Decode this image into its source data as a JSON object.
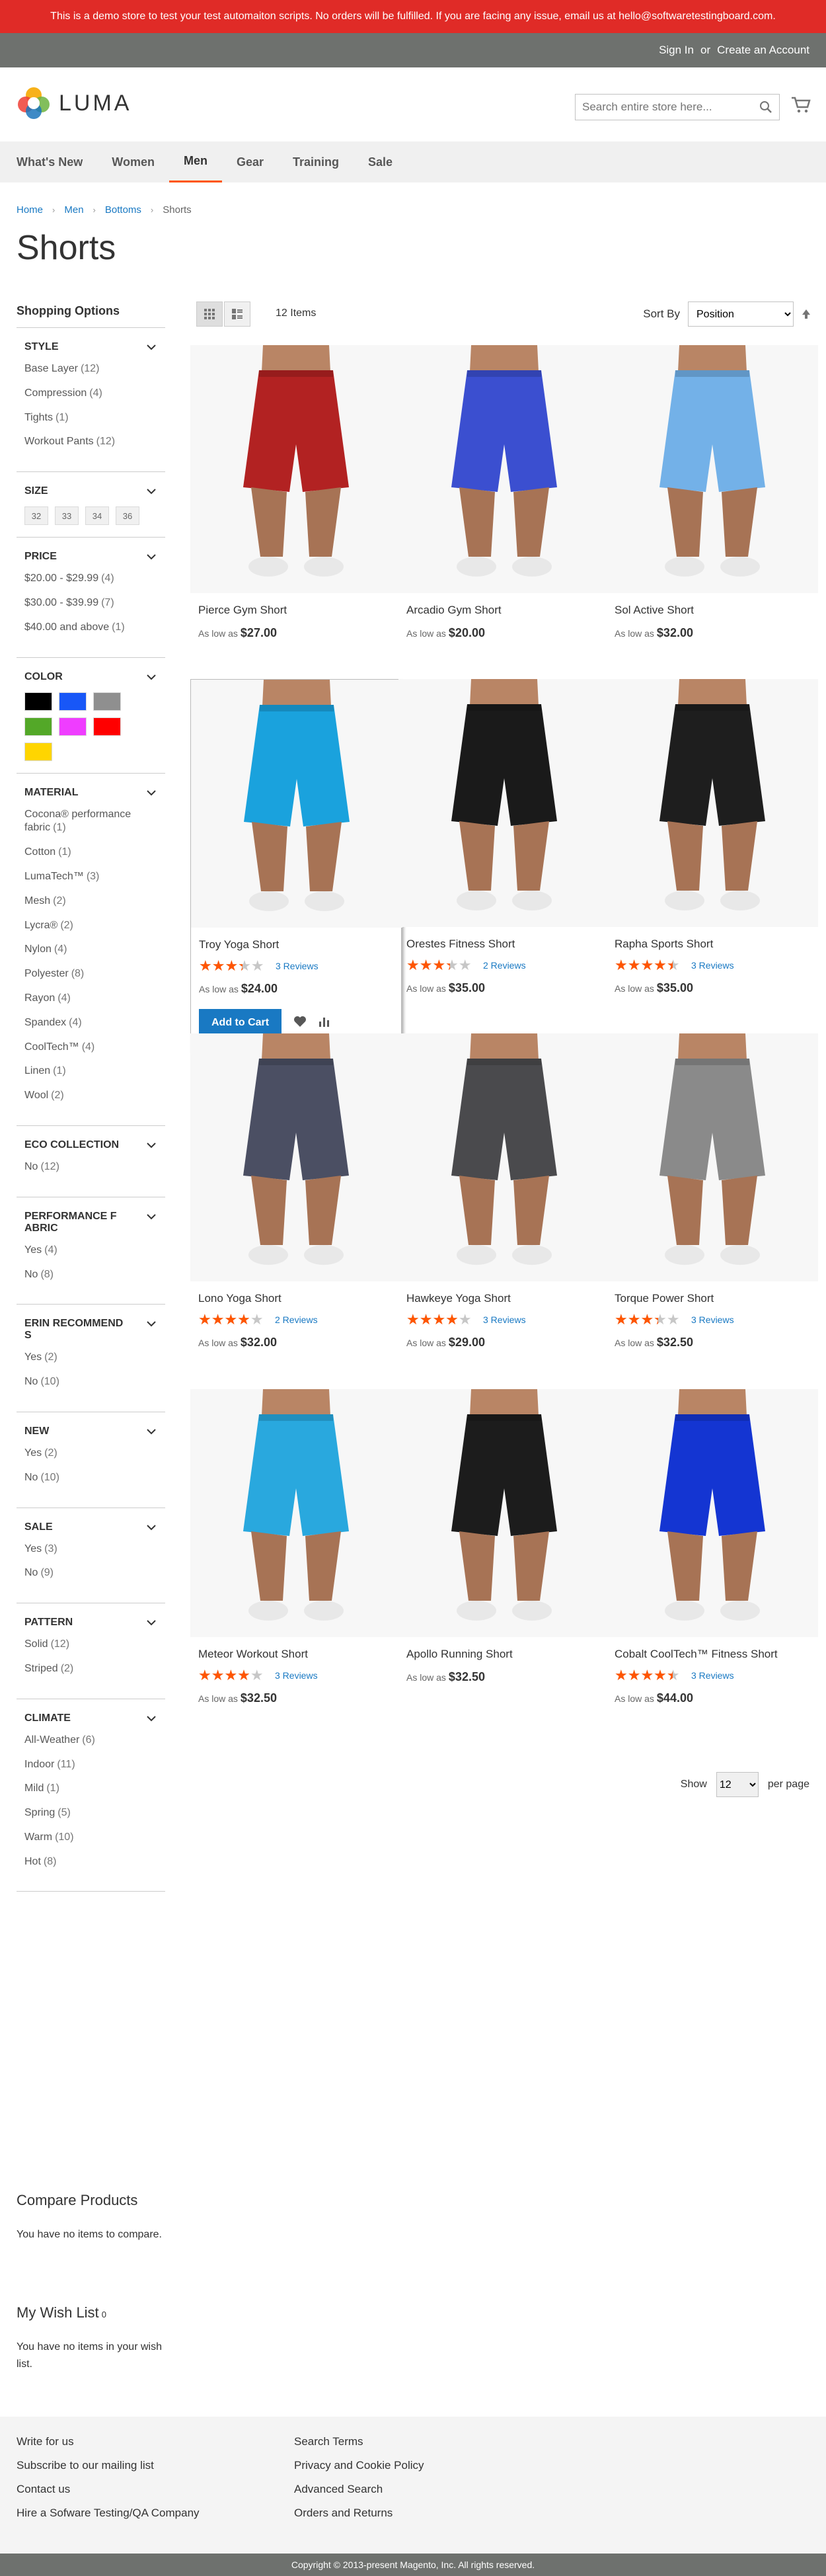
{
  "promo": "This is a demo store to test your test automaiton scripts. No orders will be fulfilled. If you are facing any issue, email us at hello@softwaretestingboard.com.",
  "topbar": {
    "signin": "Sign In",
    "or": "or",
    "create": "Create an Account"
  },
  "brand": "LUMA",
  "search": {
    "placeholder": "Search entire store here..."
  },
  "nav": [
    "What's New",
    "Women",
    "Men",
    "Gear",
    "Training",
    "Sale"
  ],
  "breadcrumb": [
    "Home",
    "Men",
    "Bottoms",
    "Shorts"
  ],
  "page_title": "Shorts",
  "toolbar": {
    "amount": "12 Items",
    "sort_label": "Sort By",
    "sort_value": "Position"
  },
  "shopping_options": "Shopping Options",
  "filters": {
    "style": {
      "title": "Style",
      "options": [
        [
          "Base Layer",
          "(12)"
        ],
        [
          "Compression",
          "(4)"
        ],
        [
          "Tights",
          "(1)"
        ],
        [
          "Workout Pants",
          "(12)"
        ]
      ]
    },
    "size": {
      "title": "Size",
      "options": [
        "32",
        "33",
        "34",
        "36"
      ]
    },
    "price": {
      "title": "Price",
      "options": [
        [
          "$20.00 - $29.99",
          "(4)"
        ],
        [
          "$30.00 - $39.99",
          "(7)"
        ],
        [
          "$40.00 and above",
          "(1)"
        ]
      ]
    },
    "color": {
      "title": "Color",
      "colors": [
        "#000000",
        "#1857f7",
        "#8f8f8f",
        "#53a828",
        "#ef3dff",
        "#ff0000",
        "#ffd500"
      ]
    },
    "material": {
      "title": "Material",
      "options": [
        [
          "Cocona® performance fabric",
          "(1)"
        ],
        [
          "Cotton",
          "(1)"
        ],
        [
          "LumaTech™",
          "(3)"
        ],
        [
          "Mesh",
          "(2)"
        ],
        [
          "Lycra®",
          "(2)"
        ],
        [
          "Nylon",
          "(4)"
        ],
        [
          "Polyester",
          "(8)"
        ],
        [
          "Rayon",
          "(4)"
        ],
        [
          "Spandex",
          "(4)"
        ],
        [
          "CoolTech™",
          "(4)"
        ],
        [
          "Linen",
          "(1)"
        ],
        [
          "Wool",
          "(2)"
        ]
      ]
    },
    "eco": {
      "title": "Eco Collection",
      "options": [
        [
          "No",
          "(12)"
        ]
      ]
    },
    "perf": {
      "title": "Performance Fabric",
      "options": [
        [
          "Yes",
          "(4)"
        ],
        [
          "No",
          "(8)"
        ]
      ]
    },
    "erin": {
      "title": "Erin Recommends",
      "options": [
        [
          "Yes",
          "(2)"
        ],
        [
          "No",
          "(10)"
        ]
      ]
    },
    "new": {
      "title": "New",
      "options": [
        [
          "Yes",
          "(2)"
        ],
        [
          "No",
          "(10)"
        ]
      ]
    },
    "sale": {
      "title": "Sale",
      "options": [
        [
          "Yes",
          "(3)"
        ],
        [
          "No",
          "(9)"
        ]
      ]
    },
    "pattern": {
      "title": "Pattern",
      "options": [
        [
          "Solid",
          "(12)"
        ],
        [
          "Striped",
          "(2)"
        ]
      ]
    },
    "climate": {
      "title": "Climate",
      "options": [
        [
          "All-Weather",
          "(6)"
        ],
        [
          "Indoor",
          "(11)"
        ],
        [
          "Mild",
          "(1)"
        ],
        [
          "Spring",
          "(5)"
        ],
        [
          "Warm",
          "(10)"
        ],
        [
          "Hot",
          "(8)"
        ]
      ]
    }
  },
  "compare": {
    "title": "Compare Products",
    "text": "You have no items to compare."
  },
  "wishlist": {
    "title": "My Wish List",
    "count": "0",
    "text": "You have no items in your wish list."
  },
  "products": [
    {
      "name": "Pierce Gym Short",
      "price": "$27.00",
      "color": "#b22222",
      "rating": 0,
      "reviews": ""
    },
    {
      "name": "Arcadio Gym Short",
      "price": "$20.00",
      "color": "#3b4fd0",
      "rating": 0,
      "reviews": ""
    },
    {
      "name": "Sol Active Short",
      "price": "$32.00",
      "color": "#73b1e8",
      "rating": 0,
      "reviews": ""
    },
    {
      "name": "Troy Yoga Short",
      "price": "$24.00",
      "color": "#1aa2dd",
      "rating": 0.6,
      "reviews": "3 Reviews"
    },
    {
      "name": "Orestes Fitness Short",
      "price": "$35.00",
      "color": "#1a1a1a",
      "rating": 0.6,
      "reviews": "2 Reviews"
    },
    {
      "name": "Rapha Sports Short",
      "price": "$35.00",
      "color": "#1e1e1e",
      "rating": 0.8,
      "reviews": "3 Reviews"
    },
    {
      "name": "Lono Yoga Short",
      "price": "$32.00",
      "color": "#4b4f63",
      "rating": 0.7,
      "reviews": "2 Reviews"
    },
    {
      "name": "Hawkeye Yoga Short",
      "price": "$29.00",
      "color": "#4a4a4d",
      "rating": 0.7,
      "reviews": "3 Reviews"
    },
    {
      "name": "Torque Power Short",
      "price": "$32.50",
      "color": "#8a8a8a",
      "rating": 0.6,
      "reviews": "3 Reviews"
    },
    {
      "name": "Meteor Workout Short",
      "price": "$32.50",
      "color": "#29a8de",
      "rating": 0.7,
      "reviews": "3 Reviews"
    },
    {
      "name": "Apollo Running Short",
      "price": "$32.50",
      "color": "#1c1c1c",
      "rating": 0,
      "reviews": ""
    },
    {
      "name": "Cobalt CoolTech™ Fitness Short",
      "price": "$44.00",
      "color": "#1435d2",
      "rating": 0.8,
      "reviews": "3 Reviews"
    }
  ],
  "price_prefix": "As low as",
  "add_to_cart": "Add to Cart",
  "pager": {
    "show": "Show",
    "value": "12",
    "per_page": "per page"
  },
  "footer": {
    "col1": [
      "Write for us",
      "Subscribe to our mailing list",
      "Contact us",
      "Hire a Sofware Testing/QA Company"
    ],
    "col2": [
      "Search Terms",
      "Privacy and Cookie Policy",
      "Advanced Search",
      "Orders and Returns"
    ]
  },
  "copyright": "Copyright © 2013-present Magento, Inc. All rights reserved."
}
